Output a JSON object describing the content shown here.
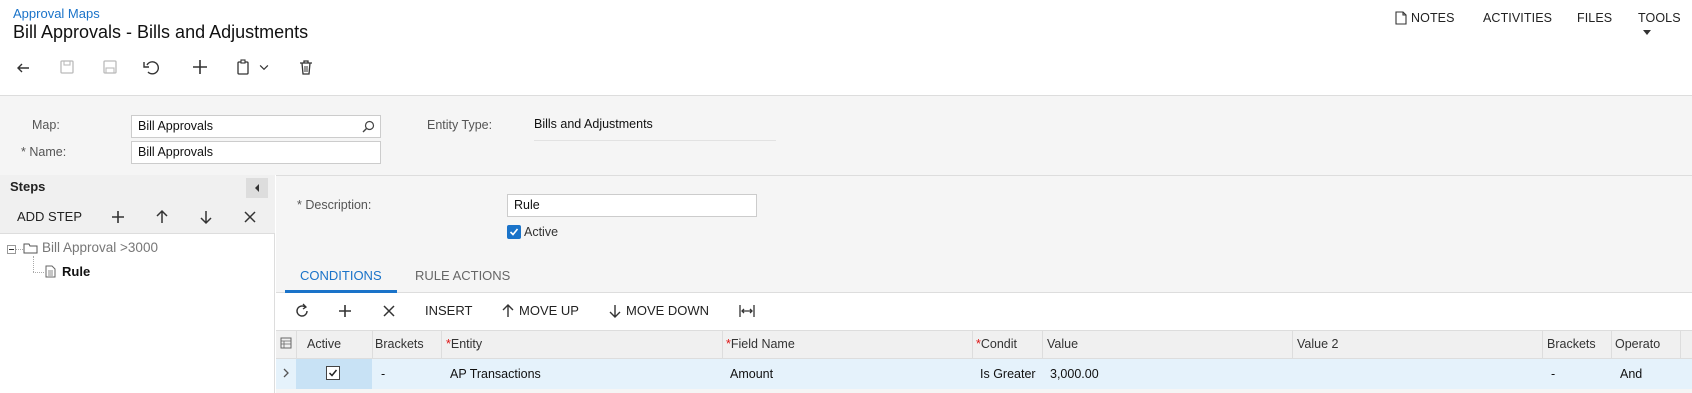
{
  "header": {
    "breadcrumb": "Approval Maps",
    "title": "Bill Approvals - Bills and Adjustments",
    "menu": {
      "notes": "NOTES",
      "activities": "ACTIVITIES",
      "files": "FILES",
      "tools": "TOOLS"
    }
  },
  "form": {
    "map_label": "Map:",
    "map_value": "Bill Approvals",
    "name_label": "Name:",
    "name_value": "Bill Approvals",
    "entity_type_label": "Entity Type:",
    "entity_type_value": "Bills and Adjustments",
    "required_mark": "*"
  },
  "steps": {
    "title": "Steps",
    "add_step_label": "ADD STEP",
    "tree": [
      {
        "label": "Bill Approval >3000"
      },
      {
        "label": "Rule"
      }
    ]
  },
  "details": {
    "description_label": "Description:",
    "description_value": "Rule",
    "active_label": "Active",
    "active_checked": true
  },
  "tabs": [
    {
      "label": "CONDITIONS"
    },
    {
      "label": "RULE ACTIONS"
    }
  ],
  "grid_toolbar": {
    "insert": "INSERT",
    "move_up": "MOVE UP",
    "move_down": "MOVE DOWN"
  },
  "grid": {
    "columns": [
      "Active",
      "Brackets",
      "Entity",
      "Field Name",
      "Condit",
      "Value",
      "Value 2",
      "Brackets",
      "Operato"
    ],
    "rows": [
      {
        "active": true,
        "open_brackets": "-",
        "entity": "AP Transactions",
        "field_name": "Amount",
        "condition": "Is Greater",
        "value": "3,000.00",
        "value2": "",
        "close_brackets": "-",
        "operator": "And"
      }
    ]
  },
  "colors": {
    "accent": "#1a73c9",
    "selected_row": "#e5f2fb",
    "required": "#dd1111"
  }
}
